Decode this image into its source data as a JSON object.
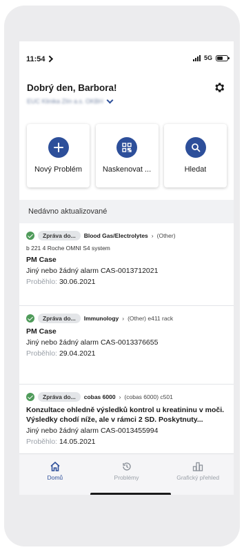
{
  "status_bar": {
    "time": "11:54",
    "network": "5G"
  },
  "header": {
    "greeting": "Dobrý den, Barbora!",
    "organization": "EUC Klinika Zlín a.s. OKBH"
  },
  "tiles": [
    {
      "label": "Nový Problém",
      "icon": "plus-icon"
    },
    {
      "label": "Naskenovat ...",
      "icon": "qr-code-icon"
    },
    {
      "label": "Hledat",
      "icon": "search-icon"
    }
  ],
  "recent": {
    "title": "Nedávno aktualizované",
    "items": [
      {
        "status": "Zpráva do...",
        "category": "Blood Gas/Electrolytes",
        "subcategory": "(Other)",
        "system": "b 221 4 Roche OMNI S4 system",
        "title": "PM Case",
        "description": "Jiný nebo žádný alarm CAS-0013712021",
        "date_label": "Proběhlo:",
        "date": "30.06.2021"
      },
      {
        "status": "Zpráva do...",
        "category": "Immunology",
        "subcategory": "(Other) e411 rack",
        "title": "PM Case",
        "description": "Jiný nebo žádný alarm CAS-0013376655",
        "date_label": "Proběhlo:",
        "date": "29.04.2021"
      },
      {
        "status": "Zpráva do...",
        "category": "cobas 6000",
        "subcategory": "(cobas 6000) c501",
        "title": "Konzultace ohledně výsledků kontrol u kreatininu v moči. Výsledky chodí níže, ale v rámci 2 SD. Poskytnuty...",
        "description": "Jiný nebo žádný alarm CAS-0013455994",
        "date_label": "Proběhlo:",
        "date": "14.05.2021"
      }
    ]
  },
  "nav": [
    {
      "label": "Domů",
      "icon": "home-icon",
      "active": true
    },
    {
      "label": "Problémy",
      "icon": "history-icon",
      "active": false
    },
    {
      "label": "Grafický přehled",
      "icon": "bar-chart-icon",
      "active": false
    }
  ],
  "colors": {
    "primary": "#2d4f9a",
    "success": "#4f9b5a",
    "muted": "#9aa0a8"
  }
}
